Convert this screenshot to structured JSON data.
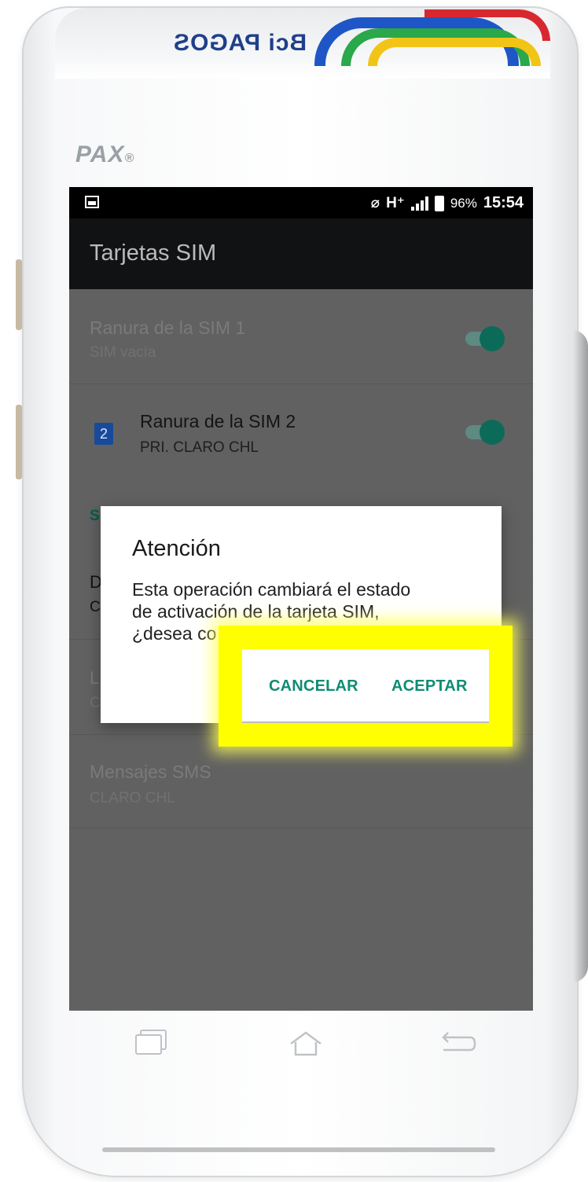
{
  "device": {
    "brand_top": "Bci PAGOS",
    "maker_logo": "PAX"
  },
  "statusbar": {
    "network_type": "H⁺",
    "battery_percent": "96%",
    "time": "15:54",
    "icons": [
      "image-icon",
      "no-sim-icon",
      "signal-icon",
      "battery-icon"
    ]
  },
  "appbar": {
    "title": "Tarjetas SIM"
  },
  "sim_slots": [
    {
      "title": "Ranura de la SIM 1",
      "subtitle": "SIM vacía",
      "enabled": true
    },
    {
      "title": "Ranura de la SIM 2",
      "subtitle": "PRI. CLARO CHL",
      "badge": "2",
      "enabled": true
    }
  ],
  "partially_hidden": {
    "section_letter": "S",
    "row1_letter": "D",
    "row1_sub_letter": "C",
    "row2_letter": "L",
    "row2_sub_letter": "C"
  },
  "sms_row": {
    "title": "Mensajes SMS",
    "subtitle": "CLARO CHL"
  },
  "dialog": {
    "title": "Atención",
    "message_line1": "Esta operación cambiará el estado",
    "message_line2": "de activación de la tarjeta SIM,",
    "message_line3": "¿desea co",
    "cancel_label": "CANCELAR",
    "accept_label": "ACEPTAR"
  },
  "colors": {
    "accent": "#0f8c73",
    "highlight": "#ffff00",
    "scrim": "#616161",
    "appbar": "#111213"
  },
  "nav": [
    "recents-icon",
    "home-icon",
    "back-icon"
  ]
}
